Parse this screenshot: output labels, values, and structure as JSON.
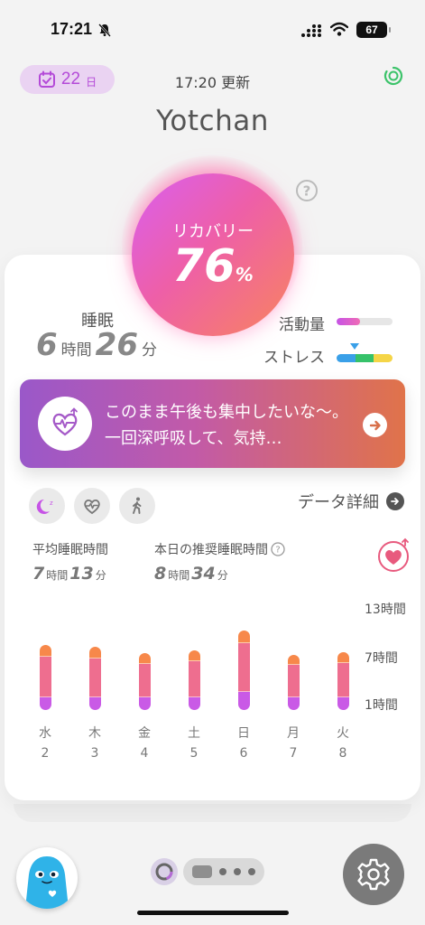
{
  "status_bar": {
    "time": "17:21",
    "battery": "67"
  },
  "header": {
    "date_num": "22",
    "date_unit": "日",
    "updated": "17:20 更新",
    "username": "Yotchan"
  },
  "recovery": {
    "label": "リカバリー",
    "value": "76",
    "unit": "%",
    "percent": 76
  },
  "sleep": {
    "label": "睡眠",
    "hours": "6",
    "hours_unit": "時間",
    "minutes": "26",
    "minutes_unit": "分"
  },
  "activity": {
    "label": "活動量",
    "level": 0.42
  },
  "stress": {
    "label": "ストレス",
    "colors": [
      "#3aa0e8",
      "#36c26a",
      "#f5d547"
    ]
  },
  "banner": {
    "message": "このまま午後も集中したいな〜。一回深呼吸して、気持…"
  },
  "detail_link": "データ詳細",
  "stats": {
    "avg_label": "平均睡眠時間",
    "avg_hours": "7",
    "avg_hours_unit": "時間",
    "avg_minutes": "13",
    "avg_minutes_unit": "分",
    "rec_label": "本日の推奨睡眠時間",
    "rec_hours": "8",
    "rec_hours_unit": "時間",
    "rec_minutes": "34",
    "rec_minutes_unit": "分"
  },
  "chart_data": {
    "type": "bar",
    "y_ticks": [
      "13時間",
      "7時間",
      "1時間"
    ],
    "categories": [
      {
        "weekday": "水",
        "date": "2"
      },
      {
        "weekday": "木",
        "date": "3"
      },
      {
        "weekday": "金",
        "date": "4"
      },
      {
        "weekday": "土",
        "date": "5"
      },
      {
        "weekday": "日",
        "date": "6"
      },
      {
        "weekday": "月",
        "date": "7"
      },
      {
        "weekday": "火",
        "date": "8"
      }
    ],
    "series": [
      {
        "color": "#c95ae6",
        "values": [
          1.5,
          1.5,
          1.5,
          1.5,
          2.2,
          1.5,
          1.5
        ]
      },
      {
        "color": "#ee6e8f",
        "values": [
          5.0,
          4.8,
          4.1,
          4.4,
          6.0,
          4.0,
          4.2
        ]
      },
      {
        "color": "#f7884a",
        "values": [
          1.4,
          1.4,
          1.3,
          1.4,
          1.5,
          1.2,
          1.3
        ]
      }
    ],
    "ylim": [
      0,
      13
    ]
  },
  "colors": {
    "accent": "#b44ad8",
    "orb_start": "#d95ff0",
    "orb_end": "#f8845e"
  }
}
